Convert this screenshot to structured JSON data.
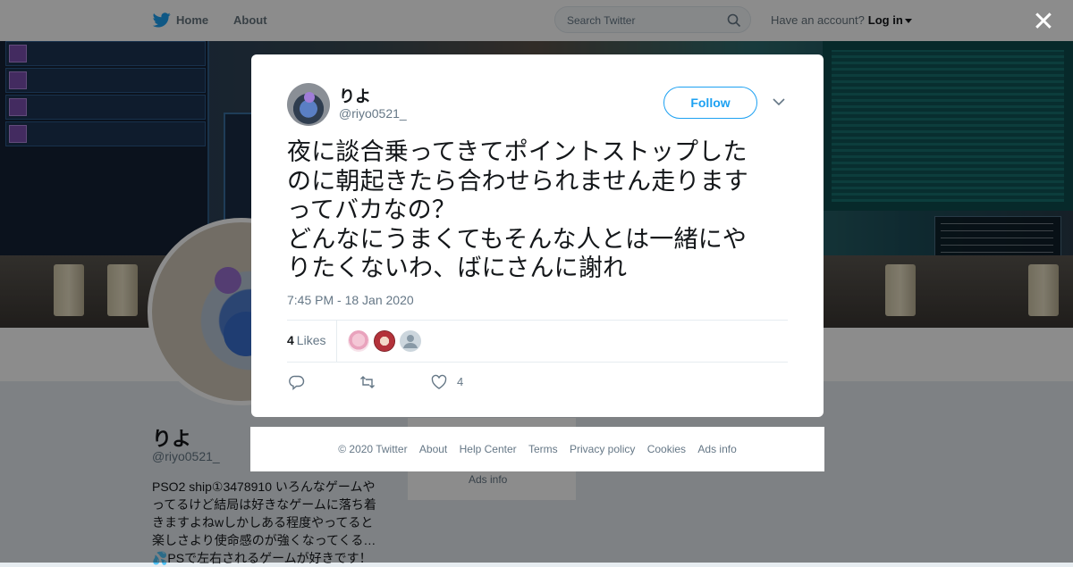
{
  "nav": {
    "home": "Home",
    "about": "About",
    "search_placeholder": "Search Twitter",
    "have_account": "Have an account?",
    "login": "Log in"
  },
  "profile": {
    "name": "りよ",
    "handle": "@riyo0521_",
    "bio_lines": [
      "PSO2 ship①3478910 いろんなゲームや",
      "ってるけど結局は好きなゲームに落ち着",
      "きますよねwしかしある程度やってると",
      "楽しさより使命感のが強くなってくる…",
      "💦PSで左右されるゲームが好きです！"
    ],
    "sidebar_ads": "Ads info"
  },
  "tweet": {
    "author_name": "りよ",
    "author_handle": "@riyo0521_",
    "follow_label": "Follow",
    "text": "夜に談合乗ってきてポイントストップした\nのに朝起きたら合わせられません走ります\nってバカなの？\nどんなにうまくてもそんな人とは一緒にや\nりたくないわ、ばにさんに謝れ",
    "timestamp": "7:45 PM - 18 Jan 2020",
    "likes_count": "4",
    "likes_label": "Likes",
    "like_action_count": "4"
  },
  "footer": {
    "copyright": "© 2020 Twitter",
    "about": "About",
    "help": "Help Center",
    "terms": "Terms",
    "privacy": "Privacy policy",
    "cookies": "Cookies",
    "ads": "Ads info"
  },
  "colors": {
    "accent": "#1da1f2",
    "text": "#14171a",
    "muted": "#657786"
  }
}
